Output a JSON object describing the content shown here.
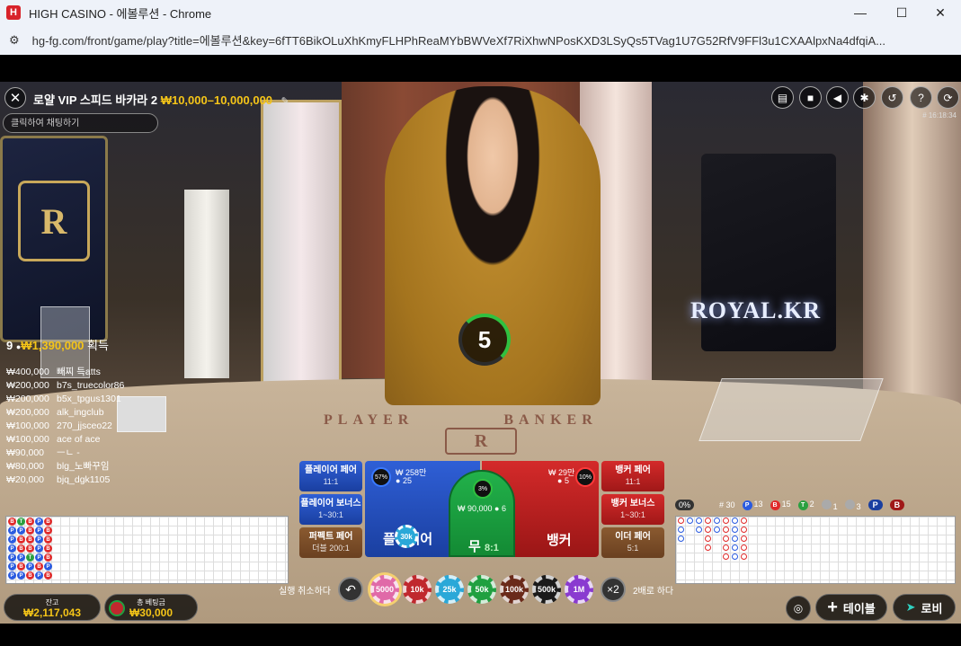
{
  "browser": {
    "title": "HIGH CASINO - 에볼루션 - Chrome",
    "favicon": "H",
    "url": "hg-fg.com/front/game/play?title=에볼루션&key=6fTT6BikOLuXhKmyFLHPhReaMYbBWVeXf7RiXhwNPosKXD3LSyQs5TVag1U7G52RfV9FFl3u1CXAAlpxNa4dfqiA...",
    "controls": [
      "—",
      "☐",
      "✕"
    ]
  },
  "game": {
    "title": "로얄 VIP 스피드 바카라 2",
    "limits": "₩10,000–10,000,000",
    "chat_placeholder": "클릭하여 채팅하기",
    "game_id": "# 16:18:34",
    "timer": "5",
    "scene_text": {
      "royal_kr": "ROYAL.KR",
      "player": "PLAYER",
      "banker": "BANKER",
      "logo": "R"
    }
  },
  "top_icons": [
    "chat-icon",
    "video-icon",
    "volume-icon",
    "gear-icon",
    "history-icon",
    "help-icon",
    "refresh-icon"
  ],
  "winners": {
    "count": "9",
    "total": "₩1,390,000",
    "suffix": "획득",
    "rows": [
      {
        "amount": "₩400,000",
        "name": "빼찌 득atts"
      },
      {
        "amount": "₩200,000",
        "name": "b7s_truecolor86"
      },
      {
        "amount": "₩200,000",
        "name": "b5x_tpgus1301"
      },
      {
        "amount": "₩200,000",
        "name": "alk_ingclub"
      },
      {
        "amount": "₩100,000",
        "name": "270_jjsceo22"
      },
      {
        "amount": "₩100,000",
        "name": "ace of ace"
      },
      {
        "amount": "₩90,000",
        "name": "ㅡㄴ -"
      },
      {
        "amount": "₩80,000",
        "name": "blg_노빠꾸임"
      },
      {
        "amount": "₩20,000",
        "name": "bjq_dgk1105"
      }
    ]
  },
  "bets": {
    "player_pair": {
      "label": "플레이어 페어",
      "odds": "11:1"
    },
    "player_bonus": {
      "label": "플레이어 보너스",
      "odds": "1~30:1"
    },
    "perfect_pair": {
      "label": "퍼펙트 페어",
      "odds": "더블 200:1"
    },
    "banker_pair": {
      "label": "뱅커 페어",
      "odds": "11:1"
    },
    "banker_bonus": {
      "label": "뱅커 보너스",
      "odds": "1~30:1"
    },
    "either_pair": {
      "label": "이더 페어",
      "odds": "5:1"
    },
    "player": {
      "label": "플레이어",
      "pct": "57%",
      "amount": "₩ 258만",
      "players": "25",
      "chip": "30k"
    },
    "tie": {
      "label": "무",
      "odds": "8:1",
      "pct": "3%",
      "amount": "₩ 90,000",
      "players": "6"
    },
    "banker": {
      "label": "뱅커",
      "pct": "10%",
      "amount": "₩ 29만",
      "players": "5"
    }
  },
  "chips": {
    "undo_label": "실행 취소하다",
    "double_label": "2배로 하다",
    "double": "×2",
    "items": [
      {
        "label": "5000",
        "color": "#e06aa8"
      },
      {
        "label": "10k",
        "color": "#c0282e"
      },
      {
        "label": "25k",
        "color": "#2aa8d8"
      },
      {
        "label": "50k",
        "color": "#20a040"
      },
      {
        "label": "100k",
        "color": "#6a2a1a"
      },
      {
        "label": "500k",
        "color": "#1a1a1a"
      },
      {
        "label": "1M",
        "color": "#8a3ad0"
      }
    ]
  },
  "stats": {
    "zero": "0%",
    "rounds": "# 30",
    "player": "13",
    "banker": "15",
    "tie": "2",
    "ppair": "1",
    "bpair": "3",
    "p_letter": "P",
    "b_letter": "B",
    "t_letter": "T"
  },
  "bead_road": [
    [
      "B",
      "P",
      "P",
      "P",
      "P",
      "P",
      "P"
    ],
    [
      "T",
      "P",
      "B",
      "B",
      "P",
      "B",
      "P"
    ],
    [
      "B",
      "B",
      "B",
      "B",
      "T",
      "P",
      "B"
    ],
    [
      "P",
      "P",
      "P",
      "P",
      "P",
      "B",
      "P"
    ],
    [
      "B",
      "B",
      "B",
      "B",
      "B",
      "P",
      "B"
    ]
  ],
  "big_road": [
    [
      "B",
      "P",
      "P"
    ],
    [
      "P"
    ],
    [
      "P",
      "P"
    ],
    [
      "B",
      "B",
      "B",
      "B"
    ],
    [
      "P",
      "P"
    ],
    [
      "B",
      "B",
      "B",
      "B",
      "B"
    ],
    [
      "P",
      "P",
      "P",
      "P",
      "P"
    ],
    [
      "B",
      "B",
      "B",
      "B",
      "B"
    ]
  ],
  "footer": {
    "balance_label": "잔고",
    "balance": "₩2,117,043",
    "total_bet_label": "총 베팅금",
    "total_bet": "₩30,000",
    "tables_label": "테이블",
    "lobby_label": "로비"
  }
}
